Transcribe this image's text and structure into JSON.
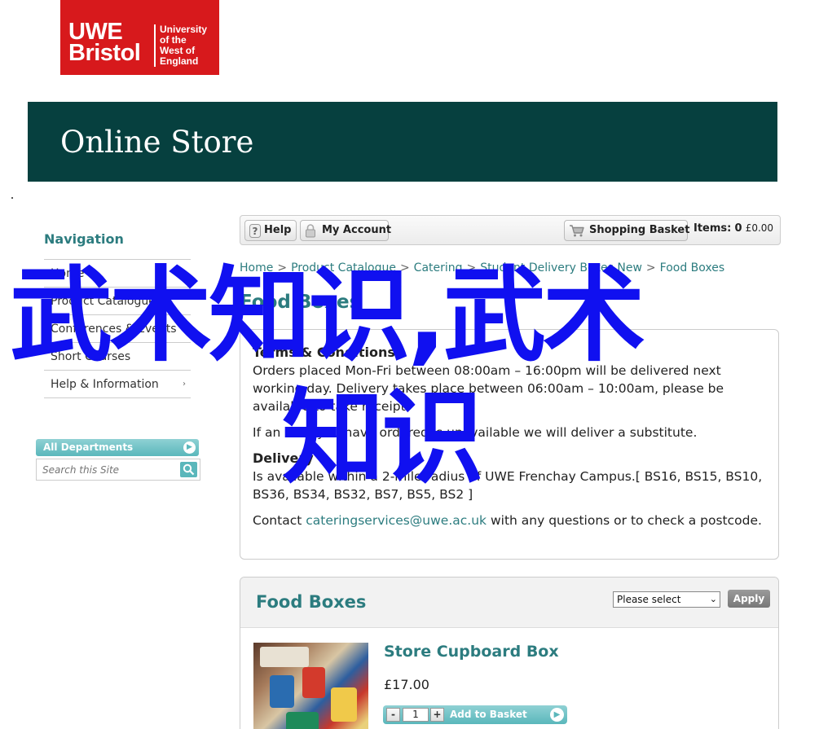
{
  "logo": {
    "line1": "UWE",
    "line2": "Bristol",
    "uni1": "University",
    "uni2": "of the",
    "uni3": "West of",
    "uni4": "England"
  },
  "banner": {
    "title": "Online Store"
  },
  "sidebar": {
    "title": "Navigation",
    "items": [
      {
        "label": "Home"
      },
      {
        "label": "Product Catalogue"
      },
      {
        "label": "Conferences & Events"
      },
      {
        "label": "Short Courses"
      },
      {
        "label": "Help & Information",
        "arrow": "›"
      }
    ],
    "departments_label": "All Departments",
    "search_placeholder": "Search this Site"
  },
  "toolbar": {
    "help_label": "Help",
    "account_label": "My Account",
    "basket_label": "Shopping Basket",
    "items_label": "Items:",
    "items_count": "0",
    "items_total": "£0.00"
  },
  "breadcrumb": [
    "Home",
    "Product Catalogue",
    "Catering",
    "Student Delivery Boxes New",
    "Food Boxes"
  ],
  "page_title": "Food Boxes",
  "info": {
    "terms_heading": "Terms & Conditions",
    "terms_text": "Orders placed Mon-Fri between 08:00am – 16:00pm will be delivered next working day. Delivery takes place between 06:00am – 10:00am, please be available to take receipt.",
    "substitute_text": "If an item you have ordered is unavailable we will deliver a substitute.",
    "delivery_heading": "Delivery",
    "delivery_text": "Is available within a 2-mile radius of UWE Frenchay Campus.[ BS16, BS15, BS10, BS36, BS34, BS32, BS7, BS5, BS2 ]",
    "contact_prefix": "Contact ",
    "contact_email": "cateringservices@uwe.ac.uk",
    "contact_suffix": " with any questions or to check a postcode."
  },
  "products_panel": {
    "title": "Food Boxes",
    "select_value": "Please select",
    "apply_label": "Apply",
    "product": {
      "name": "Store Cupboard Box",
      "price": "£17.00",
      "quantity": "1",
      "add_label": "Add to Basket"
    }
  },
  "watermark": {
    "line1": "武术知识,武术",
    "line2": "知识"
  },
  "colors": {
    "brand_red": "#d7191c",
    "banner": "#06403f",
    "accent": "#2c7c7f",
    "watermark": "#1010f0"
  }
}
